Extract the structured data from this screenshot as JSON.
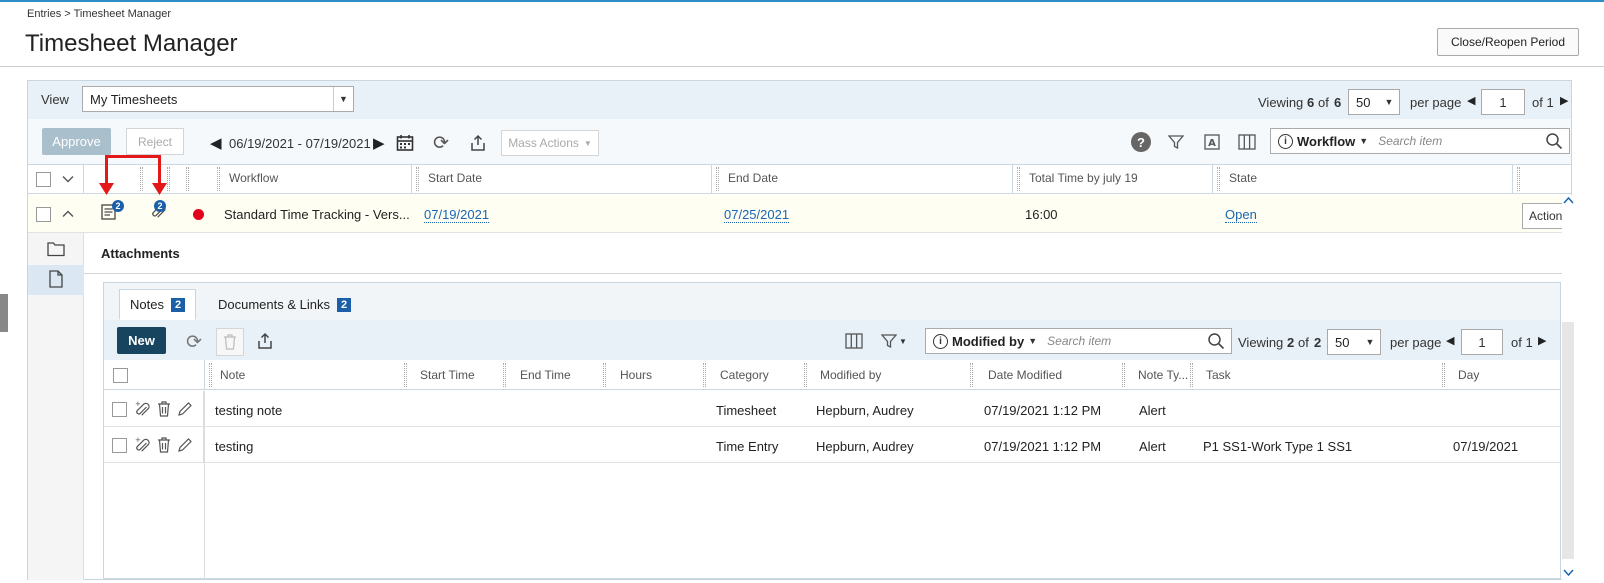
{
  "breadcrumb": "Entries > Timesheet Manager",
  "page_title": "Timesheet Manager",
  "close_reopen_label": "Close/Reopen Period",
  "view": {
    "label": "View",
    "selected": "My Timesheets"
  },
  "paging": {
    "viewing_label": "Viewing",
    "count": "6",
    "of_label": "of",
    "total": "6",
    "per_page_value": "50",
    "per_page_label": "per page",
    "page_value": "1",
    "of_pages": "of 1"
  },
  "toolbar": {
    "approve": "Approve",
    "reject": "Reject",
    "date_range": "06/19/2021 - 07/19/2021",
    "mass_actions": "Mass Actions",
    "search_filter": "Workflow",
    "search_placeholder": "Search item"
  },
  "columns": [
    "Workflow",
    "Start Date",
    "End Date",
    "Total Time by july 19",
    "State"
  ],
  "timesheet_row": {
    "notes_badge": "2",
    "attach_badge": "2",
    "workflow": "Standard Time Tracking - Vers...",
    "start_date": "07/19/2021",
    "end_date": "07/25/2021",
    "total_time": "16:00",
    "state": "Open",
    "action": "Action"
  },
  "attachments_label": "Attachments",
  "tabs": [
    {
      "label": "Notes",
      "count": "2"
    },
    {
      "label": "Documents & Links",
      "count": "2"
    }
  ],
  "notes_toolbar": {
    "new": "New",
    "search_filter": "Modified by",
    "search_placeholder": "Search item",
    "viewing_label": "Viewing",
    "count": "2",
    "of_label": "of",
    "total": "2",
    "per_page_value": "50",
    "per_page_label": "per page",
    "page_value": "1",
    "of_pages": "of 1"
  },
  "notes_columns": [
    "Note",
    "Start Time",
    "End Time",
    "Hours",
    "Category",
    "Modified by",
    "Date Modified",
    "Note Ty...",
    "Task",
    "Day"
  ],
  "notes_rows": [
    {
      "note": "testing note",
      "category": "Timesheet",
      "modified_by": "Hepburn, Audrey",
      "date_modified": "07/19/2021 1:12 PM",
      "note_type": "Alert",
      "task": "",
      "day": ""
    },
    {
      "note": "testing",
      "category": "Time Entry",
      "modified_by": "Hepburn, Audrey",
      "date_modified": "07/19/2021 1:12 PM",
      "note_type": "Alert",
      "task": "P1 SS1-Work Type 1 SS1",
      "day": "07/19/2021"
    }
  ],
  "colors": {
    "accent": "#1a66b3",
    "new_button": "#17445e",
    "annotation_arrow": "#e31818",
    "status_dot": "#e2001a"
  }
}
